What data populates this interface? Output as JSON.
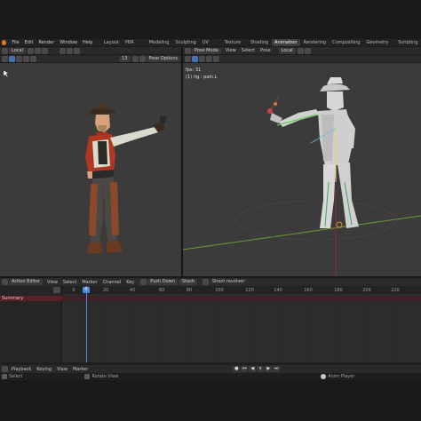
{
  "top_menu": {
    "file": "File",
    "edit": "Edit",
    "render": "Render",
    "window": "Window",
    "help": "Help"
  },
  "workspace_tabs": [
    "Layout",
    "PBR Painter",
    "Modeling",
    "Sculpting",
    "UV Editing",
    "Texture Paint",
    "Shading",
    "Animation",
    "Rendering",
    "Compositing",
    "Geometry Nodes",
    "Scripting"
  ],
  "active_tab": "Animation",
  "left_viewport": {
    "orientation": "Local",
    "frame": "13",
    "pose_options": "Pose Options"
  },
  "right_viewport": {
    "mode": "Pose Mode",
    "menu": {
      "view": "View",
      "select": "Select",
      "pose": "Pose"
    },
    "orientation": "Local",
    "overlay_fps": "fps: 31",
    "overlay_object": "(1) rig : pain.L"
  },
  "action_editor": {
    "title": "Action Editor",
    "menu": {
      "view": "View",
      "select": "Select",
      "marker": "Marker",
      "channel": "Channel",
      "key": "Key"
    },
    "push_down": "Push Down",
    "stash": "Stash",
    "action_name": "Shoot revolver",
    "channel_summary": "Summary",
    "ruler_ticks": [
      "0",
      "20",
      "40",
      "60",
      "80",
      "100",
      "120",
      "140",
      "160",
      "180",
      "200",
      "220"
    ],
    "current_frame": "0"
  },
  "timeline": {
    "playback": "Playback",
    "keying": "Keying",
    "view": "View",
    "marker": "Marker"
  },
  "status_bar": {
    "select": "Select",
    "rotate_view": "Rotate View",
    "object": "Anim Player"
  },
  "colors": {
    "accent_blue": "#4772b3",
    "summary_red": "#5a2024",
    "viewport_bg": "#3b3b3b"
  }
}
